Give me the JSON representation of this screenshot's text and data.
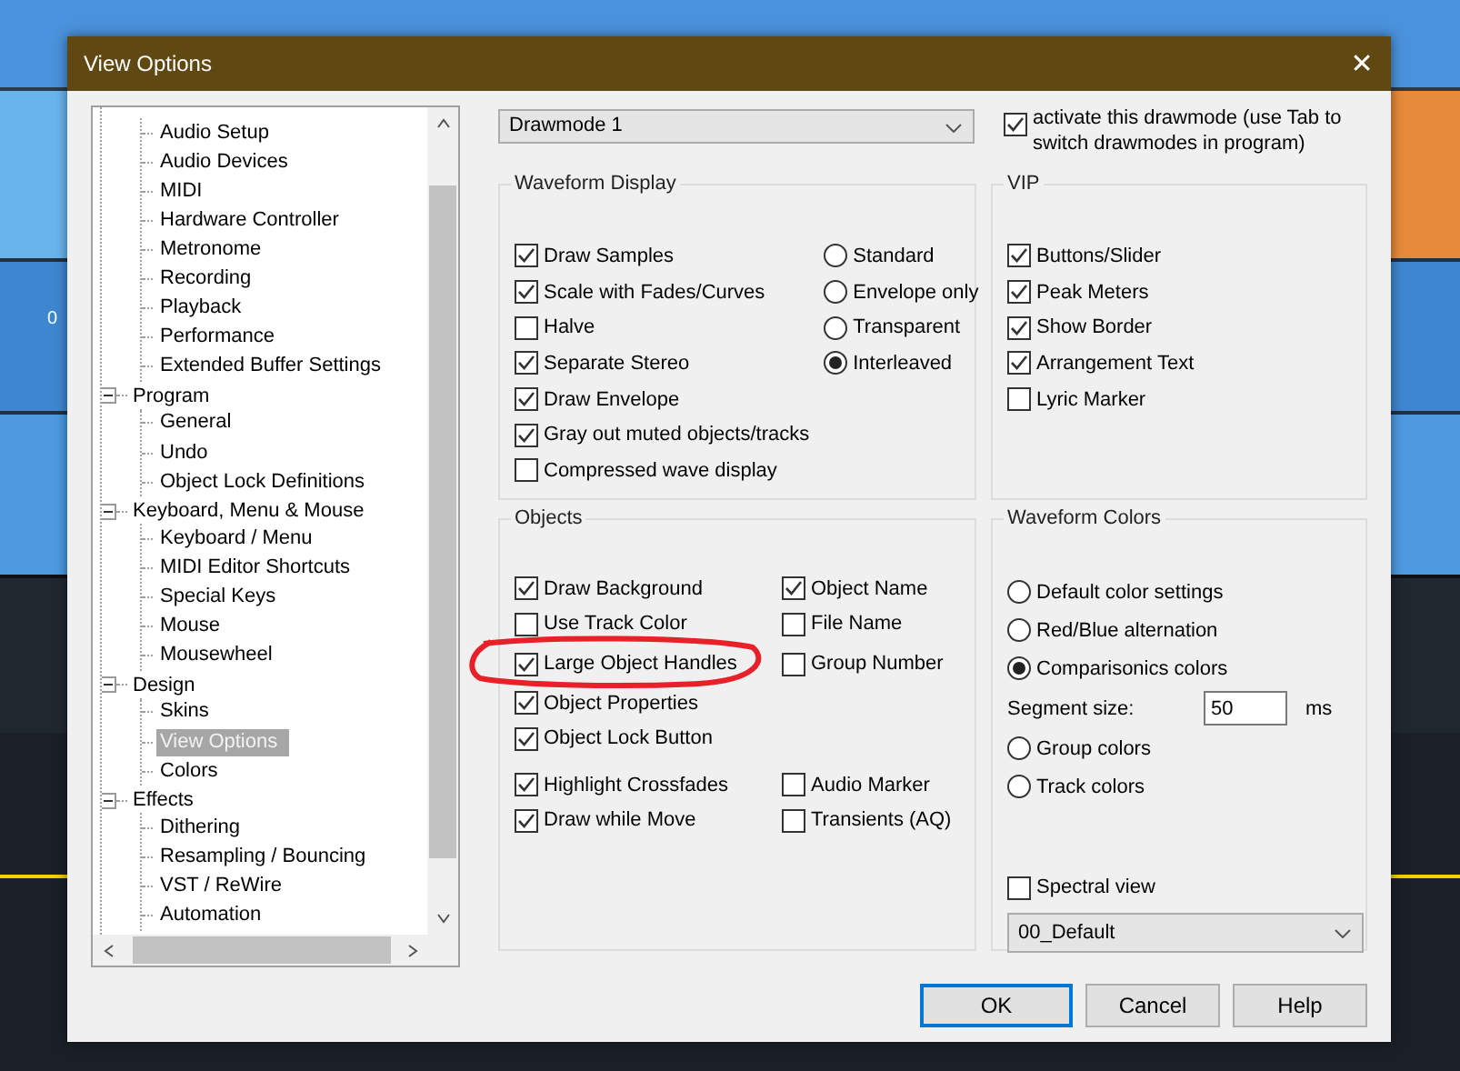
{
  "background": {
    "track_label": "0"
  },
  "window": {
    "title": "View Options",
    "close": "✕"
  },
  "tree": {
    "groups": [
      {
        "expanded": true,
        "children": [
          {
            "label": "Audio Setup",
            "selected": false
          },
          {
            "label": "Audio Devices",
            "selected": false
          },
          {
            "label": "MIDI",
            "selected": false
          },
          {
            "label": "Hardware Controller",
            "selected": false
          },
          {
            "label": "Metronome",
            "selected": false
          },
          {
            "label": "Recording",
            "selected": false
          },
          {
            "label": "Playback",
            "selected": false
          },
          {
            "label": "Performance",
            "selected": false
          },
          {
            "label": "Extended Buffer Settings",
            "selected": false
          }
        ]
      },
      {
        "label": "Program",
        "expanded": true,
        "children": [
          {
            "label": "General",
            "selected": false
          },
          {
            "label": "Undo",
            "selected": false
          },
          {
            "label": "Object Lock Definitions",
            "selected": false
          }
        ]
      },
      {
        "label": "Keyboard, Menu & Mouse",
        "expanded": true,
        "children": [
          {
            "label": "Keyboard / Menu",
            "selected": false
          },
          {
            "label": "MIDI Editor Shortcuts",
            "selected": false
          },
          {
            "label": "Special Keys",
            "selected": false
          },
          {
            "label": "Mouse",
            "selected": false
          },
          {
            "label": "Mousewheel",
            "selected": false
          }
        ]
      },
      {
        "label": "Design",
        "expanded": true,
        "children": [
          {
            "label": "Skins",
            "selected": false
          },
          {
            "label": "View Options",
            "selected": true
          },
          {
            "label": "Colors",
            "selected": false
          }
        ]
      },
      {
        "label": "Effects",
        "expanded": true,
        "children": [
          {
            "label": "Dithering",
            "selected": false
          },
          {
            "label": "Resampling / Bouncing",
            "selected": false
          },
          {
            "label": "VST / ReWire",
            "selected": false
          },
          {
            "label": "Automation",
            "selected": false
          }
        ]
      }
    ]
  },
  "drawmode": {
    "value": "Drawmode 1"
  },
  "activate": {
    "label": "activate this drawmode (use Tab to switch drawmodes in program)",
    "checked": true
  },
  "waveform_display": {
    "title": "Waveform Display",
    "checkboxes": [
      {
        "label": "Draw Samples",
        "checked": true
      },
      {
        "label": "Scale with Fades/Curves",
        "checked": true
      },
      {
        "label": "Halve",
        "checked": false
      },
      {
        "label": "Separate Stereo",
        "checked": true
      },
      {
        "label": "Draw Envelope",
        "checked": true
      },
      {
        "label": "Gray out muted objects/tracks",
        "checked": true
      },
      {
        "label": "Compressed wave display",
        "checked": false
      }
    ],
    "radios": [
      {
        "label": "Standard",
        "selected": false
      },
      {
        "label": "Envelope only",
        "selected": false
      },
      {
        "label": "Transparent",
        "selected": false
      },
      {
        "label": "Interleaved",
        "selected": true
      }
    ]
  },
  "vip": {
    "title": "VIP",
    "checkboxes": [
      {
        "label": "Buttons/Slider",
        "checked": true
      },
      {
        "label": "Peak Meters",
        "checked": true
      },
      {
        "label": "Show Border",
        "checked": true
      },
      {
        "label": "Arrangement Text",
        "checked": true
      },
      {
        "label": "Lyric Marker",
        "checked": false
      }
    ]
  },
  "objects": {
    "title": "Objects",
    "blocks": [
      {
        "rows": [
          [
            {
              "label": "Draw Background",
              "checked": true,
              "circled": false
            },
            {
              "label": "Object Name",
              "checked": true,
              "circled": false
            }
          ],
          [
            {
              "label": "Use Track Color",
              "checked": false,
              "circled": false
            },
            {
              "label": "File Name",
              "checked": false,
              "circled": false
            }
          ],
          [
            {
              "label": "Large Object Handles",
              "checked": true,
              "circled": true
            },
            {
              "label": "Group Number",
              "checked": false,
              "circled": false
            }
          ],
          [
            {
              "label": "Object Properties",
              "checked": true,
              "circled": false
            }
          ],
          [
            {
              "label": "Object Lock Button",
              "checked": true,
              "circled": false
            }
          ]
        ]
      },
      {
        "rows": [
          [
            {
              "label": "Highlight Crossfades",
              "checked": true,
              "circled": false
            },
            {
              "label": "Audio Marker",
              "checked": false,
              "circled": false
            }
          ],
          [
            {
              "label": "Draw while Move",
              "checked": true,
              "circled": false
            },
            {
              "label": "Transients (AQ)",
              "checked": false,
              "circled": false
            }
          ]
        ]
      }
    ]
  },
  "waveform_colors": {
    "title": "Waveform Colors",
    "items": [
      {
        "kind": "radio",
        "label": "Default color settings",
        "selected": false
      },
      {
        "kind": "radio",
        "label": "Red/Blue alternation",
        "selected": false
      },
      {
        "kind": "radio",
        "label": "Comparisonics colors",
        "selected": true
      },
      {
        "kind": "field",
        "label": "Segment size:",
        "value": "50",
        "unit": "ms"
      },
      {
        "kind": "radio",
        "label": "Group colors",
        "selected": false
      },
      {
        "kind": "radio",
        "label": "Track colors",
        "selected": false
      }
    ],
    "spectral": {
      "label": "Spectral view",
      "checked": false
    },
    "preset": {
      "value": "00_Default"
    }
  },
  "buttons": [
    {
      "label": "OK",
      "default": true
    },
    {
      "label": "Cancel",
      "default": false
    },
    {
      "label": "Help",
      "default": false
    }
  ]
}
